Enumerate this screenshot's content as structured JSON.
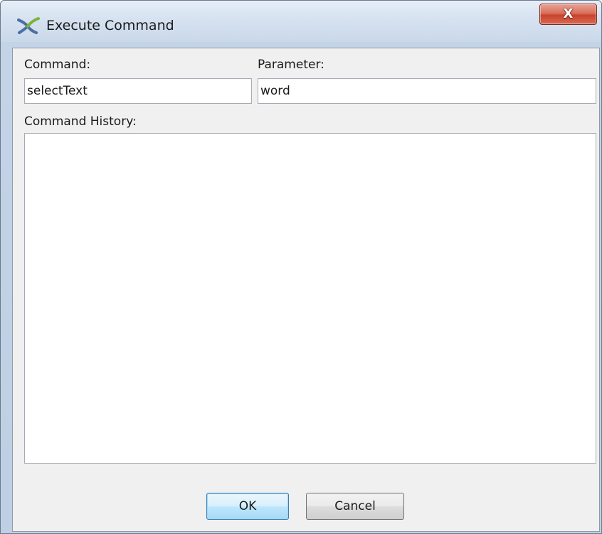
{
  "window": {
    "title": "Execute Command",
    "close_label": "X"
  },
  "form": {
    "command_label": "Command:",
    "command_value": "selectText",
    "parameter_label": "Parameter:",
    "parameter_value": "word",
    "history_label": "Command History:"
  },
  "buttons": {
    "ok_label": "OK",
    "cancel_label": "Cancel"
  },
  "icons": {
    "title_icon": "app-cross-icon",
    "close_icon": "close-icon"
  },
  "colors": {
    "close_button": "#c8432c",
    "default_button_border": "#3c7fb1"
  }
}
